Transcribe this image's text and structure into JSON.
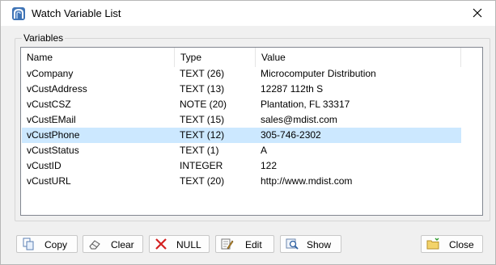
{
  "window": {
    "title": "Watch Variable List",
    "close_glyph": "✕"
  },
  "group": {
    "label": "Variables"
  },
  "table": {
    "columns": [
      "Name",
      "Type",
      "Value"
    ],
    "rows": [
      {
        "name": "vCompany",
        "type": "TEXT (26)",
        "value": "Microcomputer Distribution"
      },
      {
        "name": "vCustAddress",
        "type": "TEXT (13)",
        "value": "12287 112th S"
      },
      {
        "name": "vCustCSZ",
        "type": "NOTE (20)",
        "value": "Plantation, FL 33317"
      },
      {
        "name": "vCustEMail",
        "type": "TEXT (15)",
        "value": "sales@mdist.com"
      },
      {
        "name": "vCustPhone",
        "type": "TEXT (12)",
        "value": "305-746-2302"
      },
      {
        "name": "vCustStatus",
        "type": "TEXT (1)",
        "value": "A"
      },
      {
        "name": "vCustID",
        "type": "INTEGER",
        "value": "122"
      },
      {
        "name": "vCustURL",
        "type": "TEXT (20)",
        "value": "http://www.mdist.com"
      }
    ],
    "selected_row": "vCustPhone"
  },
  "buttons": {
    "copy": {
      "label": "Copy",
      "icon": "copy-icon"
    },
    "clear": {
      "label": "Clear",
      "icon": "eraser-icon"
    },
    "null": {
      "label": "NULL",
      "icon": "red-x-icon"
    },
    "edit": {
      "label": "Edit",
      "icon": "edit-pencil-icon"
    },
    "show": {
      "label": "Show",
      "icon": "magnifier-icon"
    },
    "close": {
      "label": "Close",
      "icon": "folder-icon"
    }
  },
  "colors": {
    "selection": "#cce8ff",
    "null_icon": "#d42020",
    "app_icon": "#3f74b6"
  }
}
